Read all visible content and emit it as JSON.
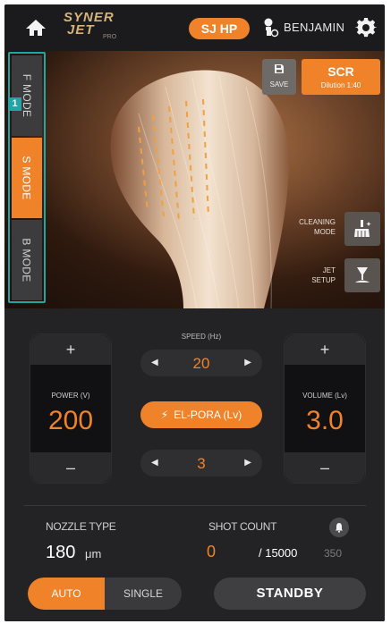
{
  "header": {
    "logo_line1": "SYNER",
    "logo_line2": "JET",
    "logo_tm": "PRO",
    "device_badge": "SJ HP",
    "username": "BENJAMIN"
  },
  "annotation": {
    "label": "1"
  },
  "modes": [
    {
      "label": "F MODE",
      "active": false
    },
    {
      "label": "S MODE",
      "active": true
    },
    {
      "label": "B MODE",
      "active": false
    }
  ],
  "hero": {
    "save_label": "SAVE",
    "scr_label": "SCR",
    "scr_sub": "Dilution 1:40",
    "cleaning_label_1": "CLEANING",
    "cleaning_label_2": "MODE",
    "jet_label_1": "JET",
    "jet_label_2": "SETUP"
  },
  "power": {
    "label": "POWER (V)",
    "value": "200",
    "plus": "+",
    "minus": "–"
  },
  "volume": {
    "label": "VOLUME (Lv)",
    "value": "3.0",
    "plus": "+",
    "minus": "–"
  },
  "speed": {
    "label": "SPEED (Hz)",
    "value": "20"
  },
  "el_pora": {
    "label": "EL-PORA (Lv)",
    "value": "3"
  },
  "nozzle": {
    "label": "NOZZLE TYPE",
    "value": "180",
    "unit": "μm"
  },
  "shot_count": {
    "label": "SHOT COUNT",
    "value": "0",
    "total": "/ 15000",
    "extra": "350"
  },
  "trigger_mode": {
    "auto": "AUTO",
    "single": "SINGLE",
    "selected": "AUTO"
  },
  "standby_label": "STANDBY",
  "colors": {
    "accent": "#f0832a",
    "annotation": "#1fa6a6",
    "background": "#1f1f21"
  }
}
